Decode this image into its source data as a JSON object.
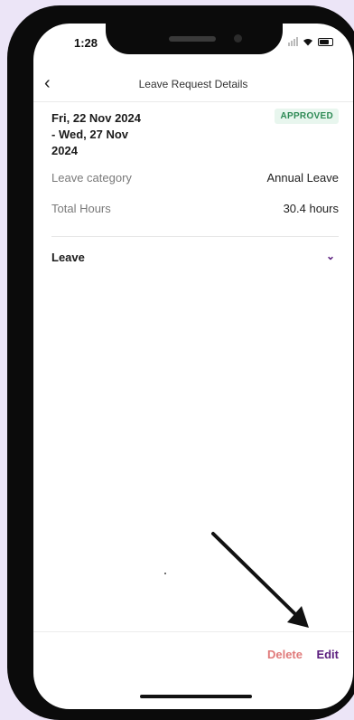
{
  "status_bar": {
    "time": "1:28"
  },
  "header": {
    "title": "Leave Request Details",
    "back_icon": "chevron-left-icon"
  },
  "request": {
    "date_line1": "Fri, 22 Nov 2024",
    "date_line2": "- Wed, 27 Nov",
    "date_line3": "2024",
    "status": "APPROVED",
    "status_color": "#2d8a55",
    "details": [
      {
        "label": "Leave category",
        "value": "Annual Leave"
      },
      {
        "label": "Total Hours",
        "value": "30.4 hours"
      }
    ]
  },
  "section": {
    "label": "Leave",
    "icon": "chevron-down-icon"
  },
  "footer": {
    "delete_label": "Delete",
    "edit_label": "Edit"
  },
  "colors": {
    "accent": "#5b1e7e",
    "danger": "#e07a7a",
    "background": "#ece5f7"
  }
}
